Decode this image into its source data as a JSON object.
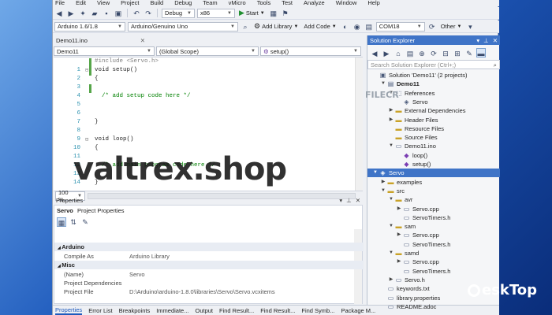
{
  "menu": [
    "File",
    "Edit",
    "View",
    "Project",
    "Build",
    "Debug",
    "Team",
    "vMicro",
    "Tools",
    "Test",
    "Analyze",
    "Window",
    "Help"
  ],
  "toolbar1": {
    "config": "Debug",
    "platform": "x86",
    "start_label": "Start"
  },
  "toolbar2": {
    "arduino_version": "Arduino 1.6/1.8",
    "board": "Arduino/Genuino Uno",
    "add_library": "Add Library",
    "add_code": "Add Code",
    "port": "COM18",
    "other": "Other"
  },
  "document": {
    "tab": "Demo11.ino",
    "nav_project": "Demo11",
    "nav_scope": "(Global Scope)",
    "nav_member": "setup()"
  },
  "code": {
    "lines": [
      {
        "n": "",
        "text": "#include <Servo.h>"
      },
      {
        "n": "1",
        "text": "void setup()"
      },
      {
        "n": "2",
        "text": "{"
      },
      {
        "n": "3",
        "text": ""
      },
      {
        "n": "4",
        "text": "  /* add setup code here */"
      },
      {
        "n": "5",
        "text": ""
      },
      {
        "n": "6",
        "text": ""
      },
      {
        "n": "7",
        "text": "}"
      },
      {
        "n": "8",
        "text": ""
      },
      {
        "n": "9",
        "text": "void loop()"
      },
      {
        "n": "10",
        "text": "{"
      },
      {
        "n": "11",
        "text": ""
      },
      {
        "n": "12",
        "text": "  /* add main program code here */"
      },
      {
        "n": "13",
        "text": ""
      },
      {
        "n": "14",
        "text": "}"
      }
    ]
  },
  "zoom": "100 %",
  "properties": {
    "title": "Properties",
    "object": "Servo",
    "object_type": "Project Properties",
    "categories": [
      {
        "name": "Arduino",
        "rows": [
          {
            "k": "Compile As",
            "v": "Arduino Library"
          }
        ]
      },
      {
        "name": "Misc",
        "rows": [
          {
            "k": "(Name)",
            "v": "Servo"
          },
          {
            "k": "Project Dependencies",
            "v": ""
          },
          {
            "k": "Project File",
            "v": "D:\\Arduino\\arduino-1.8.0\\libraries\\Servo\\Servo.vcxitems"
          }
        ]
      }
    ]
  },
  "bottom_tabs": [
    "Properties",
    "Error List",
    "Breakpoints",
    "Immediate...",
    "Output",
    "Find Result...",
    "Find Result...",
    "Find Symb...",
    "Package M..."
  ],
  "solution_explorer": {
    "title": "Solution Explorer",
    "search_placeholder": "Search Solution Explorer (Ctrl+;)",
    "items": [
      {
        "label": "Solution 'Demo11' (2 projects)",
        "depth": 0,
        "exp": "",
        "icon": "solution-icon",
        "glyph": "▣"
      },
      {
        "label": "Demo11",
        "depth": 1,
        "exp": "▼",
        "icon": "project-icon",
        "glyph": "▤",
        "bold": true
      },
      {
        "label": "References",
        "depth": 2,
        "exp": "▼",
        "icon": "references-icon",
        "glyph": "⬚"
      },
      {
        "label": "Servo",
        "depth": 3,
        "exp": "",
        "icon": "reference-item-icon",
        "glyph": "◈"
      },
      {
        "label": "External Dependencies",
        "depth": 2,
        "exp": "▶",
        "icon": "folder-icon",
        "glyph": "▬"
      },
      {
        "label": "Header Files",
        "depth": 2,
        "exp": "▶",
        "icon": "folder-icon",
        "glyph": "▬"
      },
      {
        "label": "Resource Files",
        "depth": 2,
        "exp": "",
        "icon": "folder-icon",
        "glyph": "▬"
      },
      {
        "label": "Source Files",
        "depth": 2,
        "exp": "",
        "icon": "folder-icon",
        "glyph": "▬"
      },
      {
        "label": "Demo11.ino",
        "depth": 2,
        "exp": "▼",
        "icon": "file-icon",
        "glyph": "▭"
      },
      {
        "label": "loop()",
        "depth": 3,
        "exp": "",
        "icon": "method-icon",
        "glyph": "◆"
      },
      {
        "label": "setup()",
        "depth": 3,
        "exp": "",
        "icon": "method-icon",
        "glyph": "◆"
      },
      {
        "label": "Servo",
        "depth": 0,
        "exp": "▼",
        "icon": "library-icon",
        "glyph": "◈",
        "selected": true
      },
      {
        "label": "examples",
        "depth": 1,
        "exp": "▶",
        "icon": "folder-icon",
        "glyph": "▬"
      },
      {
        "label": "src",
        "depth": 1,
        "exp": "▼",
        "icon": "folder-icon",
        "glyph": "▬"
      },
      {
        "label": "avr",
        "depth": 2,
        "exp": "▼",
        "icon": "folder-icon",
        "glyph": "▬"
      },
      {
        "label": "Servo.cpp",
        "depth": 3,
        "exp": "▶",
        "icon": "cpp-file-icon",
        "glyph": "▭"
      },
      {
        "label": "ServoTimers.h",
        "depth": 3,
        "exp": "",
        "icon": "header-file-icon",
        "glyph": "▭"
      },
      {
        "label": "sam",
        "depth": 2,
        "exp": "▼",
        "icon": "folder-icon",
        "glyph": "▬"
      },
      {
        "label": "Servo.cpp",
        "depth": 3,
        "exp": "▶",
        "icon": "cpp-file-icon",
        "glyph": "▭"
      },
      {
        "label": "ServoTimers.h",
        "depth": 3,
        "exp": "",
        "icon": "header-file-icon",
        "glyph": "▭"
      },
      {
        "label": "samd",
        "depth": 2,
        "exp": "▼",
        "icon": "folder-icon",
        "glyph": "▬"
      },
      {
        "label": "Servo.cpp",
        "depth": 3,
        "exp": "▶",
        "icon": "cpp-file-icon",
        "glyph": "▭"
      },
      {
        "label": "ServoTimers.h",
        "depth": 3,
        "exp": "",
        "icon": "header-file-icon",
        "glyph": "▭"
      },
      {
        "label": "Servo.h",
        "depth": 2,
        "exp": "▶",
        "icon": "header-file-icon",
        "glyph": "▭"
      },
      {
        "label": "keywords.txt",
        "depth": 1,
        "exp": "",
        "icon": "text-file-icon",
        "glyph": "▭"
      },
      {
        "label": "library.properties",
        "depth": 1,
        "exp": "",
        "icon": "text-file-icon",
        "glyph": "▭"
      },
      {
        "label": "README.adoc",
        "depth": 1,
        "exp": "",
        "icon": "text-file-icon",
        "glyph": "▭"
      }
    ]
  },
  "overlays": {
    "watermark": "valtrex.shop",
    "filecr": "FILECR",
    "desktop_logo": "eskTop"
  },
  "colors": {
    "accent": "#3f74c7",
    "comment": "#008000",
    "keyword": "#0000ff",
    "line_number": "#2b91af",
    "change_bar": "#57a64a"
  }
}
